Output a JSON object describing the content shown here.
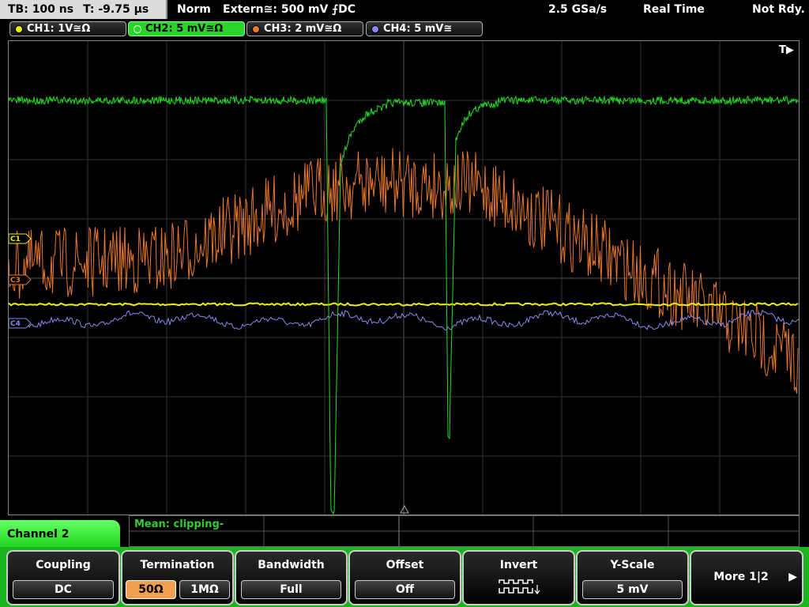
{
  "top": {
    "timebase": "TB: 100 ns",
    "trigger_time": "T: -9.75 µs",
    "mode": "Norm",
    "trigger_source": "Extern≅: 500 mV ⨍DC",
    "sample_rate": "2.5 GSa/s",
    "acq_mode": "Real Time",
    "status": "Not Rdy."
  },
  "channels": [
    {
      "label": "CH1: 1V≅Ω",
      "color": "#f0f000"
    },
    {
      "label": "CH2: 5 mV≅Ω",
      "color": "#22dd22",
      "active": true
    },
    {
      "label": "CH3: 2 mV≅Ω",
      "color": "#e8782a"
    },
    {
      "label": "CH4: 5 mV≅",
      "color": "#8888ee"
    }
  ],
  "screen": {
    "trigger_marker": "T▶",
    "ch1_marker": "C1",
    "ch3_marker": "C3",
    "ch4_marker": "C4"
  },
  "measurement": {
    "text": "Mean: clipping-"
  },
  "softkey_menu": {
    "channel_label": "Channel 2",
    "coupling": {
      "title": "Coupling",
      "value": "DC"
    },
    "termination": {
      "title": "Termination",
      "option_a": "50Ω",
      "option_b": "1MΩ",
      "selected": "50Ω"
    },
    "bandwidth": {
      "title": "Bandwidth",
      "value": "Full"
    },
    "offset": {
      "title": "Offset",
      "value": "Off"
    },
    "invert": {
      "title": "Invert",
      "icon": "invert-waveform-icon"
    },
    "yscale": {
      "title": "Y-Scale",
      "value": "5 mV"
    },
    "more": {
      "label": "More 1|2"
    }
  }
}
